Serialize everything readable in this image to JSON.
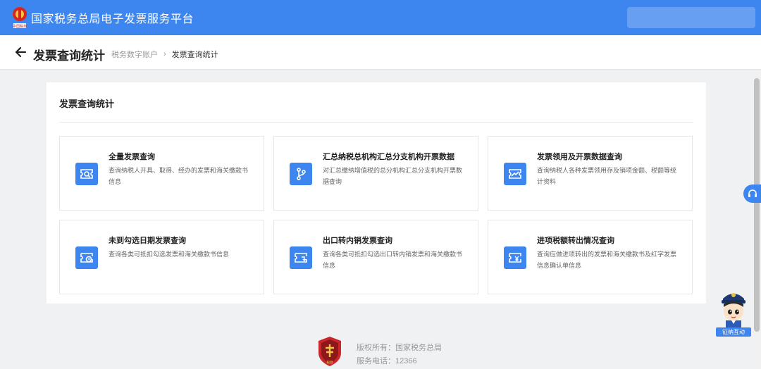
{
  "header": {
    "platform_title": "国家税务总局电子发票服务平台",
    "seal_text": "中国税务",
    "bg_color": "#3d86f0"
  },
  "subheader": {
    "title": "发票查询统计",
    "breadcrumb": [
      "税务数字账户",
      "发票查询统计"
    ],
    "back_icon": "arrow-left-icon"
  },
  "panel": {
    "section_title": "发票查询统计",
    "cards": [
      {
        "title": "全量发票查询",
        "desc": "查询纳税人开具、取得、经办的发票和海关缴款书信息",
        "icon": "invoice-search-icon"
      },
      {
        "title": "汇总纳税总机构汇总分支机构开票数据",
        "desc": "对汇总缴纳增值税的总分机构汇总分支机构开票数据查询",
        "icon": "branch-icon"
      },
      {
        "title": "发票领用及开票数据查询",
        "desc": "查询纳税人各种发票领用存及销项金额、税额等统计资料",
        "icon": "trend-icon"
      },
      {
        "title": "未到勾选日期发票查询",
        "desc": "查询各类可抵扣勾选发票和海关缴款书信息",
        "icon": "invoice-clock-icon"
      },
      {
        "title": "出口转内销发票查询",
        "desc": "查询各类可抵扣勾选出口转内销发票和海关缴款书信息",
        "icon": "invoice-return-icon"
      },
      {
        "title": "进项税额转出情况查询",
        "desc": "查询应做进项转出的发票和海关缴款书及红字发票信息确认单信息",
        "icon": "invoice-yen-icon"
      }
    ]
  },
  "floating": {
    "mascot_label": "征纳互动",
    "help_icon": "headset-icon"
  },
  "footer": {
    "copyright": "版权所有：国家税务总局",
    "phone": "服务电话：12366",
    "logo_text": "税徽"
  }
}
